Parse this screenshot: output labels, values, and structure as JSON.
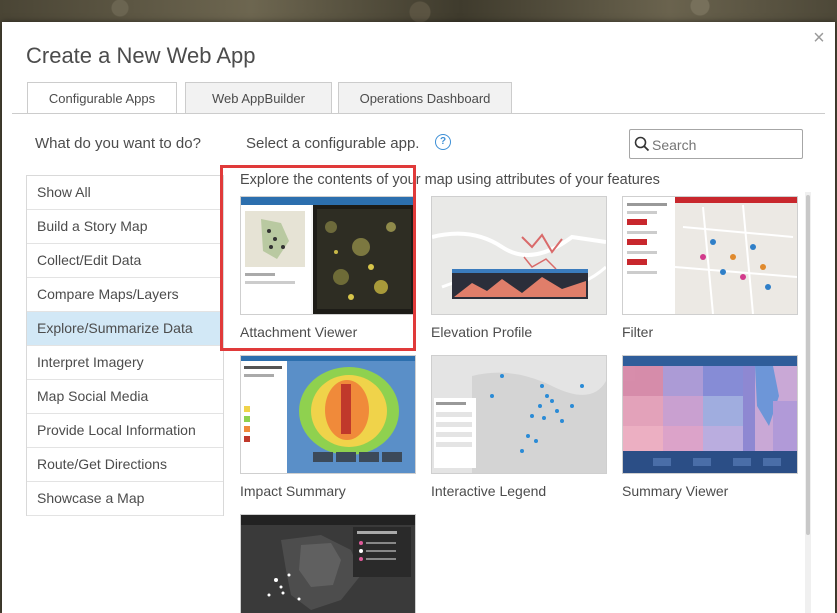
{
  "dialog": {
    "title": "Create a New Web App"
  },
  "tabs": [
    {
      "label": "Configurable Apps",
      "active": true
    },
    {
      "label": "Web AppBuilder",
      "active": false
    },
    {
      "label": "Operations Dashboard",
      "active": false
    }
  ],
  "left_prompt": "What do you want to do?",
  "right_prompt": "Select a configurable app.",
  "help": "?",
  "search": {
    "placeholder": "Search",
    "value": ""
  },
  "sidebar": {
    "items": [
      {
        "label": "Show All"
      },
      {
        "label": "Build a Story Map"
      },
      {
        "label": "Collect/Edit Data"
      },
      {
        "label": "Compare Maps/Layers"
      },
      {
        "label": "Explore/Summarize Data",
        "selected": true
      },
      {
        "label": "Interpret Imagery"
      },
      {
        "label": "Map Social Media"
      },
      {
        "label": "Provide Local Information"
      },
      {
        "label": "Route/Get Directions"
      },
      {
        "label": "Showcase a Map"
      }
    ]
  },
  "category_description": "Explore the contents of your map using attributes of your features",
  "apps": [
    {
      "label": "Attachment Viewer"
    },
    {
      "label": "Elevation Profile"
    },
    {
      "label": "Filter"
    },
    {
      "label": "Impact Summary"
    },
    {
      "label": "Interactive Legend"
    },
    {
      "label": "Summary Viewer"
    },
    {
      "label": ""
    }
  ],
  "colors": {
    "accent": "#3d8fd6",
    "selected_bg": "#d2e8f6",
    "highlight": "#e03a3a"
  }
}
